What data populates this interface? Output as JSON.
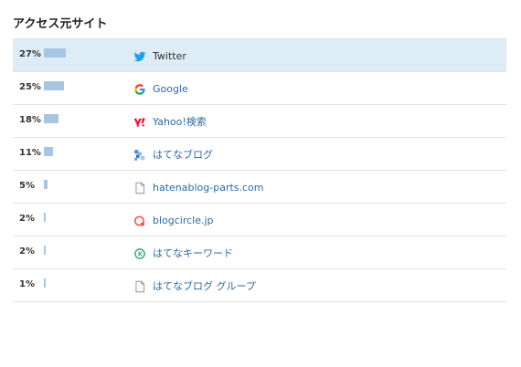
{
  "panel": {
    "title": "アクセス元サイト"
  },
  "rows": [
    {
      "percent": "27%",
      "share": 0.27,
      "label": "Twitter",
      "icon": "twitter-icon",
      "highlight": true
    },
    {
      "percent": "25%",
      "share": 0.25,
      "label": "Google",
      "icon": "google-icon",
      "highlight": false
    },
    {
      "percent": "18%",
      "share": 0.18,
      "label": "Yahoo!検索",
      "icon": "yahoo-icon",
      "highlight": false
    },
    {
      "percent": "11%",
      "share": 0.11,
      "label": "はてなブログ",
      "icon": "hatena-blog-icon",
      "highlight": false
    },
    {
      "percent": "5%",
      "share": 0.05,
      "label": "hatenablog-parts.com",
      "icon": "document-icon",
      "highlight": false
    },
    {
      "percent": "2%",
      "share": 0.02,
      "label": "blogcircle.jp",
      "icon": "blogcircle-icon",
      "highlight": false
    },
    {
      "percent": "2%",
      "share": 0.02,
      "label": "はてなキーワード",
      "icon": "hatena-keyword-icon",
      "highlight": false
    },
    {
      "percent": "1%",
      "share": 0.01,
      "label": "はてなブログ グループ",
      "icon": "document-icon",
      "highlight": false
    }
  ],
  "colors": {
    "bar": "#a7c6e3",
    "highlight_row": "#deecf6",
    "link": "#2d6aa3",
    "divider": "#e3e3e3"
  }
}
